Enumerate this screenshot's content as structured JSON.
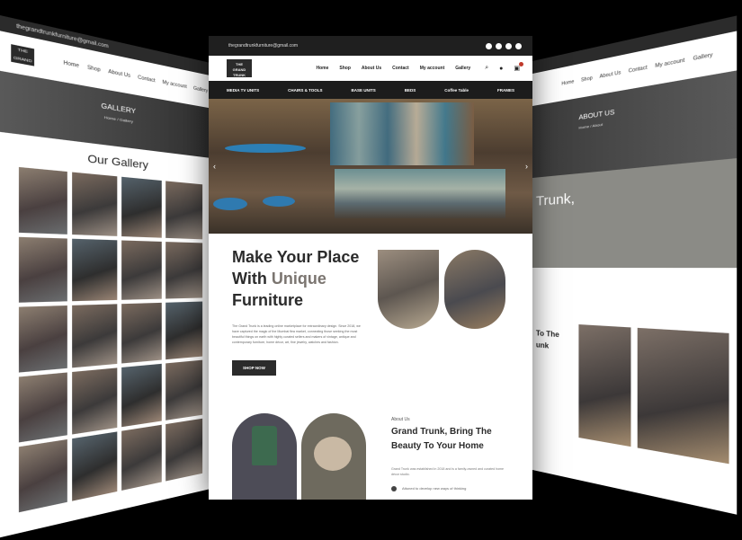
{
  "center": {
    "email": "thegrandtrunkfurniture@gmail.com",
    "logo_line1": "THE",
    "logo_line2": "GRAND",
    "logo_line3": "TRUNK",
    "menu": [
      "Home",
      "Shop",
      "About Us",
      "Contact",
      "My account",
      "Gallery"
    ],
    "categories": [
      "MEDIA TV UNITS",
      "CHAIRS & TOOLS",
      "BASE UNITS",
      "BEDS",
      "Coffee Table",
      "FRAMES"
    ],
    "hero_title_1": "Make Your Place",
    "hero_title_2a": "With ",
    "hero_title_2b": "Unique",
    "hero_title_3": "Furniture",
    "hero_para": "The Grand Trunk is a leading online marketplace for extraordinary design. Since 2018, we have captured the magic of the Mumbai flea market, connecting those seeking the most beautiful things on earth with highly curated sellers and makers of vintage, antique and contemporary furniture, home décor, art, fine jewelry, watches and fashion.",
    "shop_button": "SHOP NOW",
    "about_label": "About Us",
    "about_title": "Grand Trunk, Bring The Beauty To Your Home",
    "about_para": "Grand Trunk was established in 2018 and is a family-owned and curated home décor studio.",
    "about_check": "Attuned to develop new ways of thinking"
  },
  "left": {
    "topbar": "thegrandtrunkfurniture@gmail.com",
    "menu": [
      "Home",
      "Shop",
      "About Us",
      "Contact",
      "My account",
      "Gallery"
    ],
    "banner_title": "GALLERY",
    "banner_crumb": "Home  /  Gallery",
    "heading": "Our Gallery"
  },
  "right": {
    "menu": [
      "Home",
      "Shop",
      "About Us",
      "Contact",
      "My account",
      "Gallery"
    ],
    "banner_title": "ABOUT US",
    "banner_crumb": "Home  /  About",
    "grey_title": "Trunk,",
    "to_text_1": "To The",
    "to_text_2": "unk"
  }
}
